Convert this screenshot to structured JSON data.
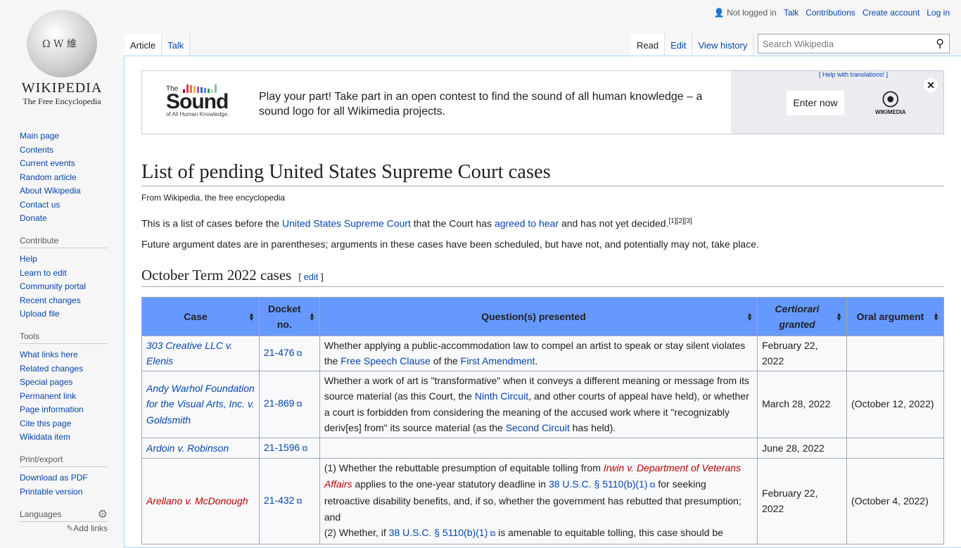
{
  "logo": {
    "wordmark": "Wikipedia",
    "tagline": "The Free Encyclopedia",
    "globe_glyphs": "Ω W 維"
  },
  "sidebar": {
    "nav": [
      "Main page",
      "Contents",
      "Current events",
      "Random article",
      "About Wikipedia",
      "Contact us",
      "Donate"
    ],
    "contribute_title": "Contribute",
    "contribute": [
      "Help",
      "Learn to edit",
      "Community portal",
      "Recent changes",
      "Upload file"
    ],
    "tools_title": "Tools",
    "tools": [
      "What links here",
      "Related changes",
      "Special pages",
      "Permanent link",
      "Page information",
      "Cite this page",
      "Wikidata item"
    ],
    "print_title": "Print/export",
    "print": [
      "Download as PDF",
      "Printable version"
    ],
    "languages_title": "Languages",
    "add_links": "Add links"
  },
  "personal": {
    "not_logged": "Not logged in",
    "talk": "Talk",
    "contributions": "Contributions",
    "create": "Create account",
    "login": "Log in"
  },
  "tabs": {
    "article": "Article",
    "talk": "Talk",
    "read": "Read",
    "edit": "Edit",
    "history": "View history"
  },
  "search": {
    "placeholder": "Search Wikipedia"
  },
  "banner": {
    "logo_the": "The",
    "logo_sound": "Sound",
    "logo_sub": "of All Human Knowledge.",
    "message": "Play your part! Take part in an open contest to find the sound of all human knowledge – a sound logo for all Wikimedia projects.",
    "help": "[ Help with translations! ]",
    "enter": "Enter now",
    "wikimedia": "WIKIMEDIA",
    "close": "✕",
    "bar_colors": [
      "#990000",
      "#dd3366",
      "#ee7722",
      "#ffbb33",
      "#aa55cc",
      "#3366cc",
      "#5588dd",
      "#339966",
      "#bbddaa",
      "#88bbaa"
    ]
  },
  "page": {
    "title": "List of pending United States Supreme Court cases",
    "from": "From Wikipedia, the free encyclopedia",
    "intro": [
      {
        "t": "This is a list of cases before the "
      },
      {
        "t": "United States Supreme Court",
        "link": true
      },
      {
        "t": " that the Court has "
      },
      {
        "t": "agreed to hear",
        "link": true
      },
      {
        "t": " and has not yet decided."
      },
      {
        "t": "[1][2][3]",
        "link": true,
        "sup": true
      }
    ],
    "note": "Future argument dates are in parentheses; arguments in these cases have been scheduled, but have not, and potentially may not, take place.",
    "section": "October Term 2022 cases",
    "edit": "edit"
  },
  "table": {
    "headers": [
      "Case",
      "Docket no.",
      "Question(s) presented",
      "Certiorari granted",
      "Oral argument"
    ],
    "rows": [
      {
        "case": "303 Creative LLC v. Elenis",
        "docket": "21-476",
        "q": [
          {
            "t": "Whether applying a public-accommodation law to compel an artist to speak or stay silent violates the "
          },
          {
            "t": "Free Speech Clause",
            "link": true
          },
          {
            "t": " of the "
          },
          {
            "t": "First Amendment",
            "link": true
          },
          {
            "t": "."
          }
        ],
        "granted": "February 22, 2022",
        "oral": ""
      },
      {
        "case": "Andy Warhol Foundation for the Visual Arts, Inc. v. Goldsmith",
        "docket": "21-869",
        "q": [
          {
            "t": "Whether a work of art is \"transformative\" when it conveys a different meaning or message from its source material (as this Court, the "
          },
          {
            "t": "Ninth Circuit",
            "link": true
          },
          {
            "t": ", and other courts of appeal have held), or whether a court is forbidden from considering the meaning of the accused work where it \"recognizably deriv[es] from\" its source material (as the "
          },
          {
            "t": "Second Circuit",
            "link": true
          },
          {
            "t": " has held)."
          }
        ],
        "granted": "March 28, 2022",
        "oral": "(October 12, 2022)"
      },
      {
        "case": "Ardoin v. Robinson",
        "docket": "21-1596",
        "q": [],
        "granted": "June 28, 2022",
        "oral": ""
      },
      {
        "case": "Arellano v. McDonough",
        "red": true,
        "docket": "21-432",
        "q": [
          {
            "t": "(1) Whether the rebuttable presumption of equitable tolling from "
          },
          {
            "t": "Irwin v. Department of Veterans Affairs",
            "red": true,
            "i": true
          },
          {
            "t": " applies to the one-year statutory deadline in "
          },
          {
            "t": "38 U.S.C. § 5110(b)(1)",
            "link": true,
            "ext": true
          },
          {
            "t": " for seeking retroactive disability benefits, and, if so, whether the government has rebutted that presumption; and"
          },
          {
            "br": true
          },
          {
            "t": "(2) Whether, if "
          },
          {
            "t": "38 U.S.C. § 5110(b)(1)",
            "link": true,
            "ext": true
          },
          {
            "t": " is amenable to equitable tolling, this case should be"
          }
        ],
        "granted": "February 22, 2022",
        "oral": "(October 4, 2022)"
      }
    ]
  }
}
